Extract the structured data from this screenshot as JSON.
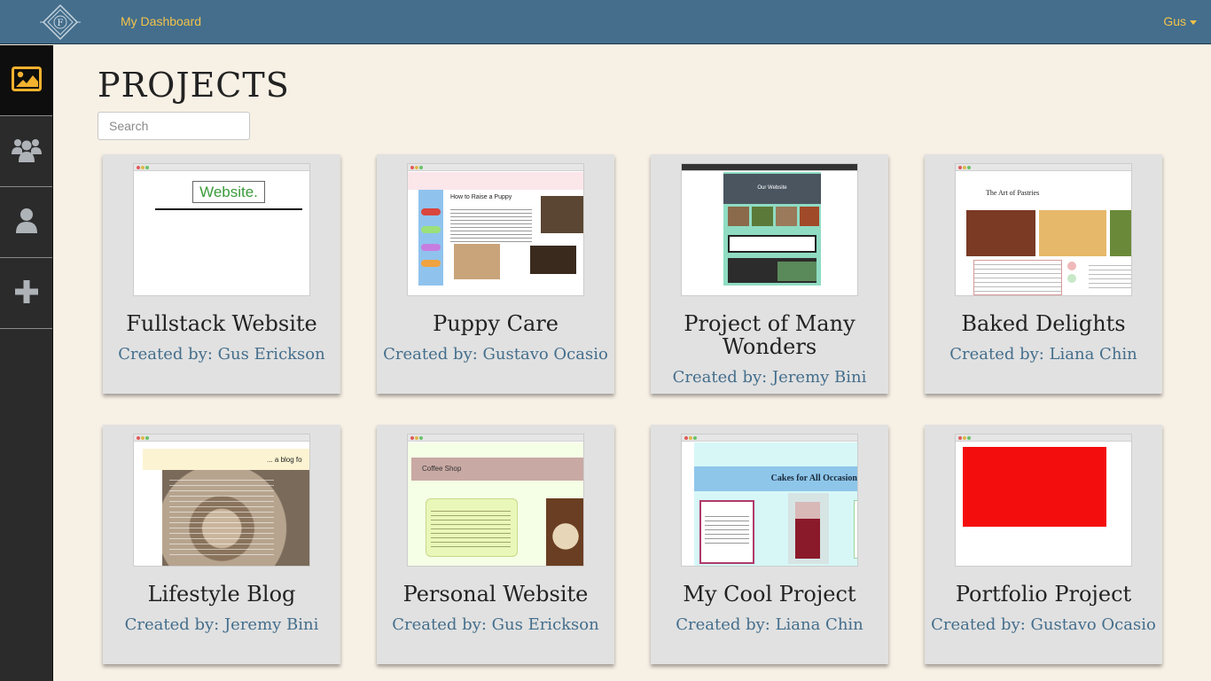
{
  "header": {
    "logo_letter": "F",
    "dashboard_link": "My Dashboard",
    "user_name": "Gus"
  },
  "sidebar": {
    "items": [
      {
        "icon": "image-icon",
        "active": true
      },
      {
        "icon": "users-icon",
        "active": false
      },
      {
        "icon": "user-icon",
        "active": false
      },
      {
        "icon": "plus-icon",
        "active": false
      }
    ]
  },
  "main": {
    "title": "PROJECTS",
    "search_placeholder": "Search"
  },
  "colors": {
    "topbar": "#446e8c",
    "accent": "#f3c34a",
    "background": "#f7f0e5",
    "sidebar": "#2b2b2b",
    "card": "#e1e1e1"
  },
  "projects": [
    {
      "title": "Fullstack Website",
      "creator": "Created by: Gus Erickson",
      "thumb_text": "Website."
    },
    {
      "title": "Puppy Care",
      "creator": "Created by: Gustavo Ocasio",
      "thumb_text": "How to Raise a Puppy"
    },
    {
      "title": "Project of Many Wonders",
      "creator": "Created by: Jeremy Bini",
      "thumb_text": "Our Website"
    },
    {
      "title": "Baked Delights",
      "creator": "Created by: Liana Chin",
      "thumb_text": "The Art of Pastries"
    },
    {
      "title": "Lifestyle Blog",
      "creator": "Created by: Jeremy Bini",
      "thumb_text": "... a blog fo"
    },
    {
      "title": "Personal Website",
      "creator": "Created by: Gus Erickson",
      "thumb_text": "Coffee Shop"
    },
    {
      "title": "My Cool Project",
      "creator": "Created by: Liana Chin",
      "thumb_text": "Cakes for All Occasion"
    },
    {
      "title": "Portfolio Project",
      "creator": "Created by: Gustavo Ocasio",
      "thumb_text": ""
    }
  ]
}
